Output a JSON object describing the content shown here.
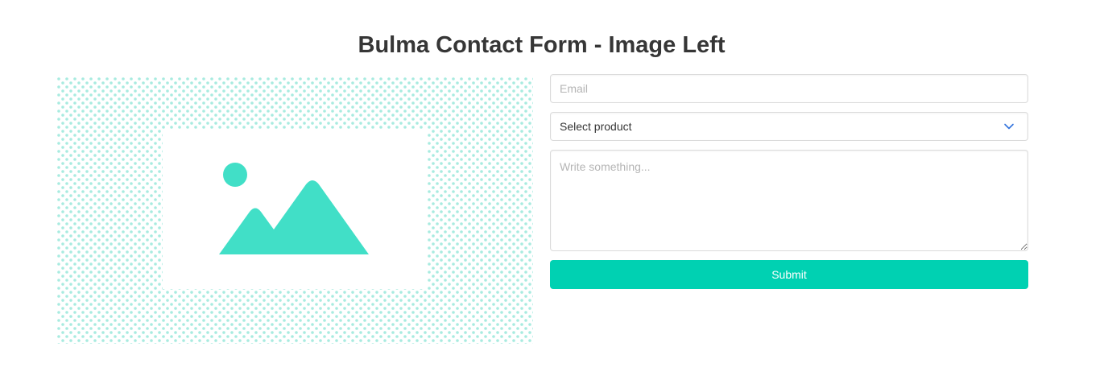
{
  "page": {
    "title": "Bulma Contact Form - Image Left"
  },
  "illustration": {
    "icon": "image-placeholder-icon",
    "pattern_color": "#a8ebe0",
    "icon_color": "#41dfc7"
  },
  "form": {
    "email": {
      "placeholder": "Email",
      "value": ""
    },
    "product": {
      "selected": "Select product"
    },
    "message": {
      "placeholder": "Write something...",
      "value": ""
    },
    "submit_label": "Submit"
  },
  "colors": {
    "accent": "#00d1b2",
    "border": "#dbdbdb",
    "placeholder": "#b5b5b5",
    "chevron": "#3273dc"
  }
}
